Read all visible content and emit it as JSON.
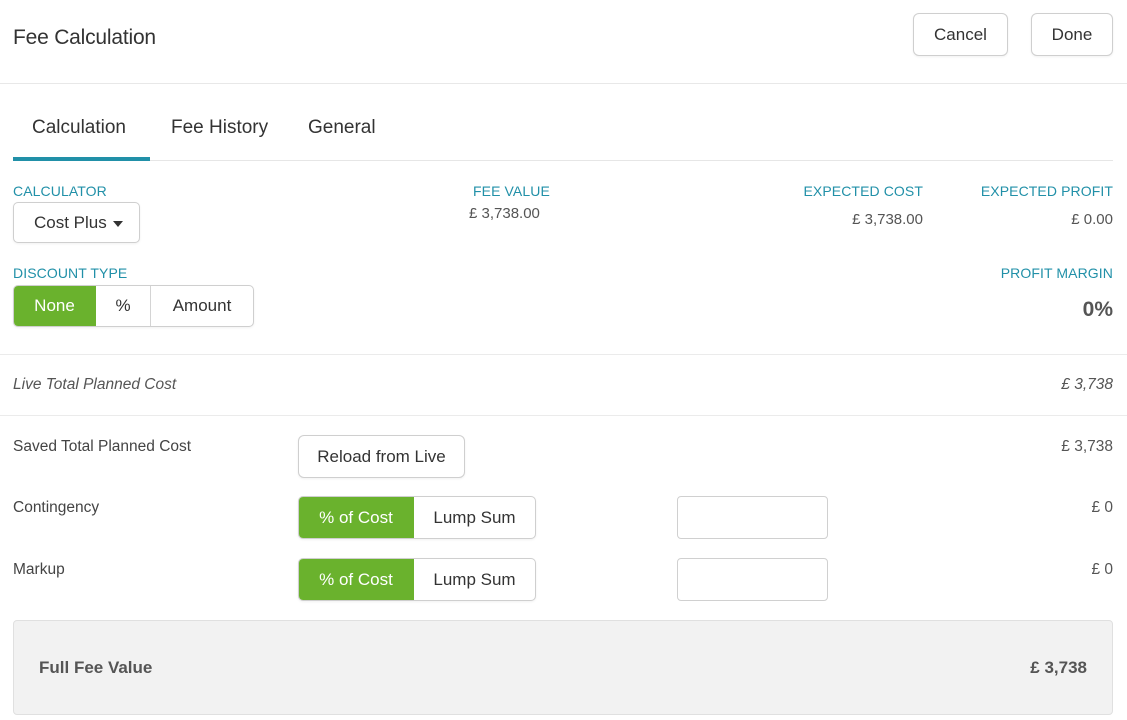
{
  "header": {
    "title": "Fee Calculation",
    "cancel_label": "Cancel",
    "done_label": "Done"
  },
  "tabs": [
    {
      "label": "Calculation",
      "active": true
    },
    {
      "label": "Fee History",
      "active": false
    },
    {
      "label": "General",
      "active": false
    }
  ],
  "summary": {
    "calculator_label": "CALCULATOR",
    "calculator_value": "Cost Plus",
    "fee_value_label": "FEE VALUE",
    "fee_value": "£ 3,738.00",
    "expected_cost_label": "EXPECTED COST",
    "expected_cost": "£ 3,738.00",
    "expected_profit_label": "EXPECTED PROFIT",
    "expected_profit": "£ 0.00",
    "discount_type_label": "DISCOUNT TYPE",
    "discount_options": [
      "None",
      "%",
      "Amount"
    ],
    "discount_selected": "None",
    "profit_margin_label": "PROFIT MARGIN",
    "profit_margin": "0%"
  },
  "live": {
    "label": "Live Total Planned Cost",
    "value": "£ 3,738"
  },
  "saved": {
    "label": "Saved Total Planned Cost",
    "reload_label": "Reload from Live",
    "value": "£ 3,738"
  },
  "contingency": {
    "label": "Contingency",
    "options": [
      "% of Cost",
      "Lump Sum"
    ],
    "selected": "% of Cost",
    "input_value": "",
    "value": "£ 0"
  },
  "markup": {
    "label": "Markup",
    "options": [
      "% of Cost",
      "Lump Sum"
    ],
    "selected": "% of Cost",
    "input_value": "",
    "value": "£ 0"
  },
  "footer": {
    "label": "Full Fee Value",
    "value": "£ 3,738"
  },
  "colors": {
    "accent": "#2190a8",
    "selected_green": "#6ab22d",
    "footer_bg": "#f2f2f2"
  }
}
